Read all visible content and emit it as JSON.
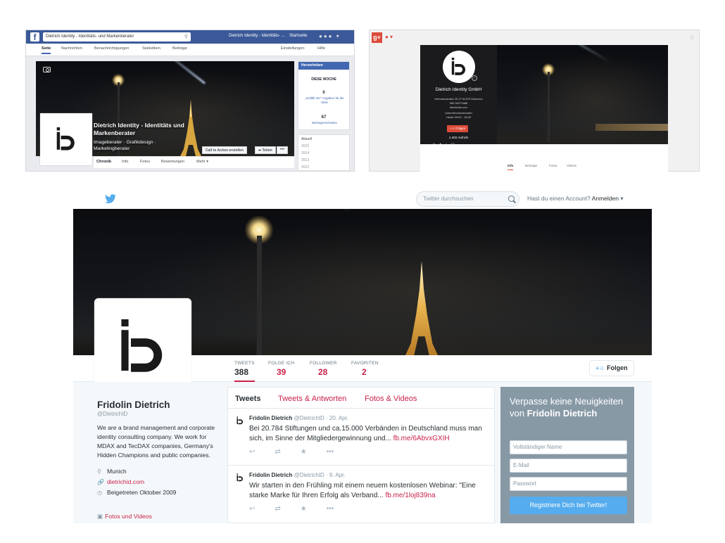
{
  "facebook": {
    "search_value": "Dietrich Identity - Identitäts- und Markenberater",
    "page_pill": "Dietrich Identity - Identitäts- ...",
    "home_label": "Startseite",
    "tabs": [
      "Seite",
      "Nachrichten",
      "Benachrichtigungen",
      "Statistiken",
      "Beiträge"
    ],
    "settings_label": "Einstellungen",
    "help_label": "Hilfe",
    "page_name": "Dietrich Identity - Identitäts und Markenberater",
    "page_category": "Imageberater · Grafikdesign · Marketingberater",
    "cta_label": "Call to Action erstellen",
    "share_label": "Teilen",
    "more_label": "•••",
    "subtabs": [
      "Chronik",
      "Info",
      "Fotos",
      "Bewertungen",
      "Mehr"
    ],
    "highlight_label": "Hervorheben",
    "week_title": "DIESE WOCHE",
    "likes_num": "0",
    "likes_text": "„Gefällt mir“-Angaben für die Seite",
    "reach_num": "67",
    "reach_text": "Beitragsreichweite",
    "years": [
      "Aktuell",
      "2015",
      "2014",
      "2013",
      "2012"
    ]
  },
  "googleplus": {
    "logo": "g+",
    "name": "Dietrich Identity GmbH",
    "address": "Hofmannstraße 25-27 81379 München",
    "phone": "089 55271888",
    "website": "dietrichid.com",
    "category": "Unternehmensberater",
    "hours": "Heute 09:00 - 18:00",
    "follow_label": "Folgen",
    "follower_count": "1.402 Aufrufe",
    "tabs": [
      "Info",
      "Beiträge",
      "Fotos",
      "Videos"
    ]
  },
  "twitter": {
    "search_placeholder": "Twitter durchsuchen",
    "account_question": "Hast du einen Account?",
    "login_label": "Anmelden",
    "stats": [
      {
        "label": "TWEETS",
        "value": "388"
      },
      {
        "label": "FOLGE ICH",
        "value": "39"
      },
      {
        "label": "FOLLOWER",
        "value": "28"
      },
      {
        "label": "FAVORITEN",
        "value": "2"
      }
    ],
    "follow_label": "Folgen",
    "name": "Fridolin Dietrich",
    "handle": "@DietrichID",
    "description": "We are a brand management and corporate identity consulting company. We work for MDAX and TecDAX companies, Germany's Hidden Champions and public companies.",
    "location": "Munich",
    "website": "dietrichid.com",
    "joined": "Beigetreten Oktober 2009",
    "photos_label": "Fotos und Videos",
    "timeline_tabs": [
      "Tweets",
      "Tweets & Antworten",
      "Fotos & Videos"
    ],
    "tweets": [
      {
        "author": "Fridolin Dietrich",
        "meta": "@DietrichID · 20. Apr.",
        "text": "Bei 20.784 Stiftungen und ca.15.000 Verbänden in Deutschland muss man sich, im Sinne der Mitgliedergewinnung und...",
        "link": "fb.me/6AbvxGXIH"
      },
      {
        "author": "Fridolin Dietrich",
        "meta": "@DietrichID · 9. Apr.",
        "text": "Wir starten in den Frühling mit einem neuem kostenlosen Webinar: \"Eine starke Marke für Ihren Erfolg als Verband...",
        "link": "fb.me/1loj839na"
      }
    ],
    "signup_title_plain": "Verpasse keine Neuigkeiten von",
    "signup_title_bold": "Fridolin Dietrich",
    "signup_fields": [
      "Vollständiger Name",
      "E-Mail",
      "Passwort"
    ],
    "signup_button": "Registriere Dich bei Twitter!"
  }
}
